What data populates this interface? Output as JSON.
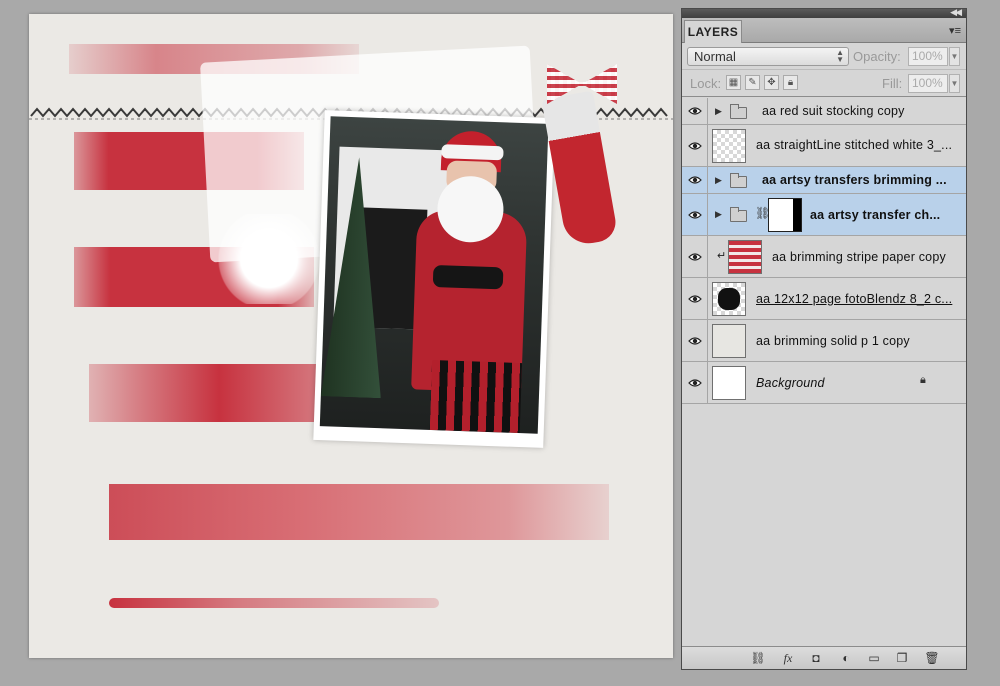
{
  "panel": {
    "tab": "LAYERS",
    "blend_mode": "Normal",
    "opacity_label": "Opacity:",
    "opacity_value": "100%",
    "lock_label": "Lock:",
    "fill_label": "Fill:",
    "fill_value": "100%"
  },
  "layers": [
    {
      "name": "aa red suit stocking copy",
      "kind": "group",
      "selected": false
    },
    {
      "name": "aa straightLine stitched white 3_...",
      "kind": "layer",
      "thumb": "transparent",
      "selected": false
    },
    {
      "name": "aa artsy transfers brimming ...",
      "kind": "group",
      "selected": true
    },
    {
      "name": "aa artsy transfer ch...",
      "kind": "group-mask",
      "selected": true
    },
    {
      "name": "aa brimming stripe paper copy",
      "kind": "clipped",
      "thumb": "stripes",
      "selected": false
    },
    {
      "name": "aa 12x12 page fotoBlendz 8_2 c...",
      "kind": "layer",
      "thumb": "mask",
      "selected": false
    },
    {
      "name": "aa brimming solid p 1 copy",
      "kind": "layer",
      "thumb": "paper",
      "selected": false
    },
    {
      "name": "Background",
      "kind": "background",
      "thumb": "white",
      "locked": true,
      "selected": false
    }
  ],
  "icons": {
    "footer": [
      "link-layers-icon",
      "fx-icon",
      "add-mask-icon",
      "adjustment-layer-icon",
      "new-group-icon",
      "new-layer-icon",
      "trash-icon"
    ]
  },
  "colors": {
    "stripe_red": "#c7323f",
    "canvas_paper": "#ebe9e5",
    "selection": "#b9d1ea"
  }
}
